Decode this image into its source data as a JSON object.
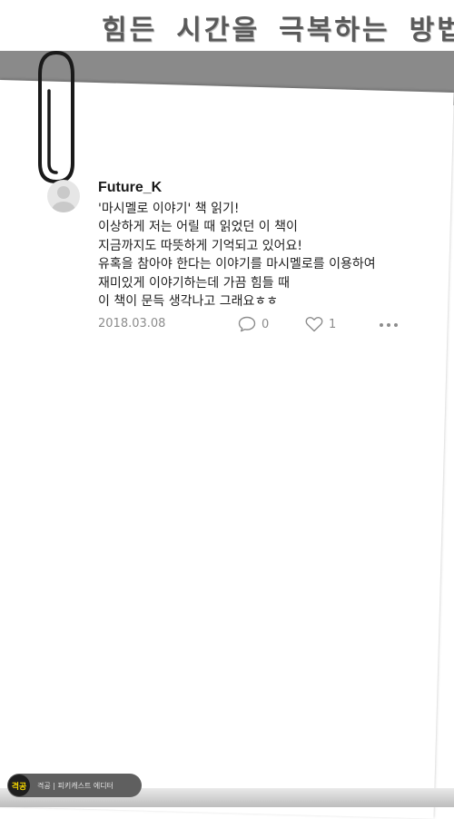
{
  "header": {
    "title": "힘든 시간을 극복하는 방법"
  },
  "post": {
    "author": "Future_K",
    "lines": [
      "'마시멜로 이야기' 책 읽기!",
      "이상하게 저는 어릴 때 읽었던 이 책이",
      "지금까지도 따뜻하게 기억되고 있어요!",
      "유혹을 참아야 한다는 이야기를 마시멜로를 이용하여",
      "재미있게 이야기하는데 가끔 힘들 때",
      "이 책이 문득 생각나고 그래요ㅎㅎ"
    ],
    "date": "2018.03.08",
    "comment_count": "0",
    "like_count": "1"
  },
  "badge": {
    "logo": "격공",
    "text": "격공 | 피키캐스트 에디터"
  },
  "icons": {
    "comment": "comment-icon",
    "like": "heart-icon",
    "more": "more-dots-icon",
    "avatar": "avatar-placeholder-icon",
    "clip": "paperclip-icon"
  },
  "colors": {
    "meta_text": "#8c8c8c",
    "band": "#8a8a8a",
    "badge_bg": "#5f5f5f",
    "badge_logo": "#f2d400"
  }
}
